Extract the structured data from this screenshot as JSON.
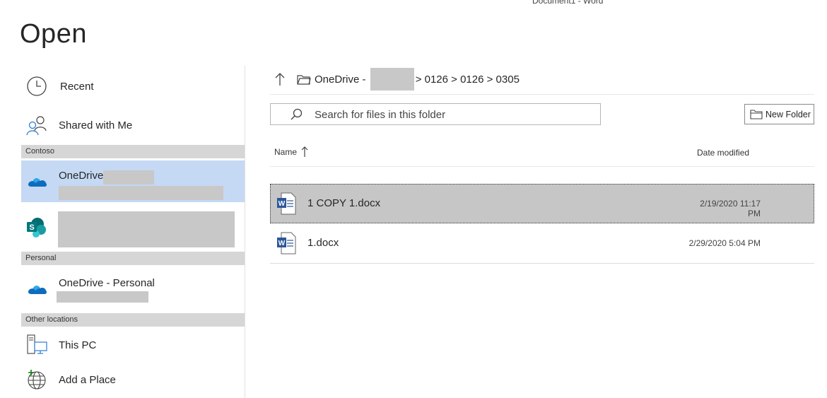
{
  "app": {
    "title": "Document1  -  Word"
  },
  "page": {
    "title": "Open"
  },
  "nav": {
    "recent": "Recent",
    "shared": "Shared with Me",
    "sections": {
      "org": "Contoso",
      "personal": "Personal",
      "other": "Other locations"
    },
    "onedrive_org": "OneDrive",
    "onedrive_personal": "OneDrive - Personal",
    "this_pc": "This PC",
    "add_place": "Add a Place"
  },
  "breadcrumb": {
    "root": "OneDrive - ",
    "path": "> 0126 > 0126 > 0305"
  },
  "search": {
    "placeholder": "Search for files in this folder"
  },
  "toolbar": {
    "new_folder": "New Folder"
  },
  "columns": {
    "name": "Name",
    "date": "Date modified"
  },
  "files": [
    {
      "name": "1 COPY 1.docx",
      "date": "2/19/2020 11:17 PM",
      "selected": true
    },
    {
      "name": "1.docx",
      "date": "2/29/2020 5:04 PM",
      "selected": false
    }
  ],
  "colors": {
    "nav_selected": "#c5d9f4",
    "row_selected": "#c6c6c6",
    "section_header": "#d6d6d6",
    "word_blue": "#2b579a",
    "onedrive_blue": "#0f6cbd",
    "sharepoint_teal": "#038387"
  }
}
